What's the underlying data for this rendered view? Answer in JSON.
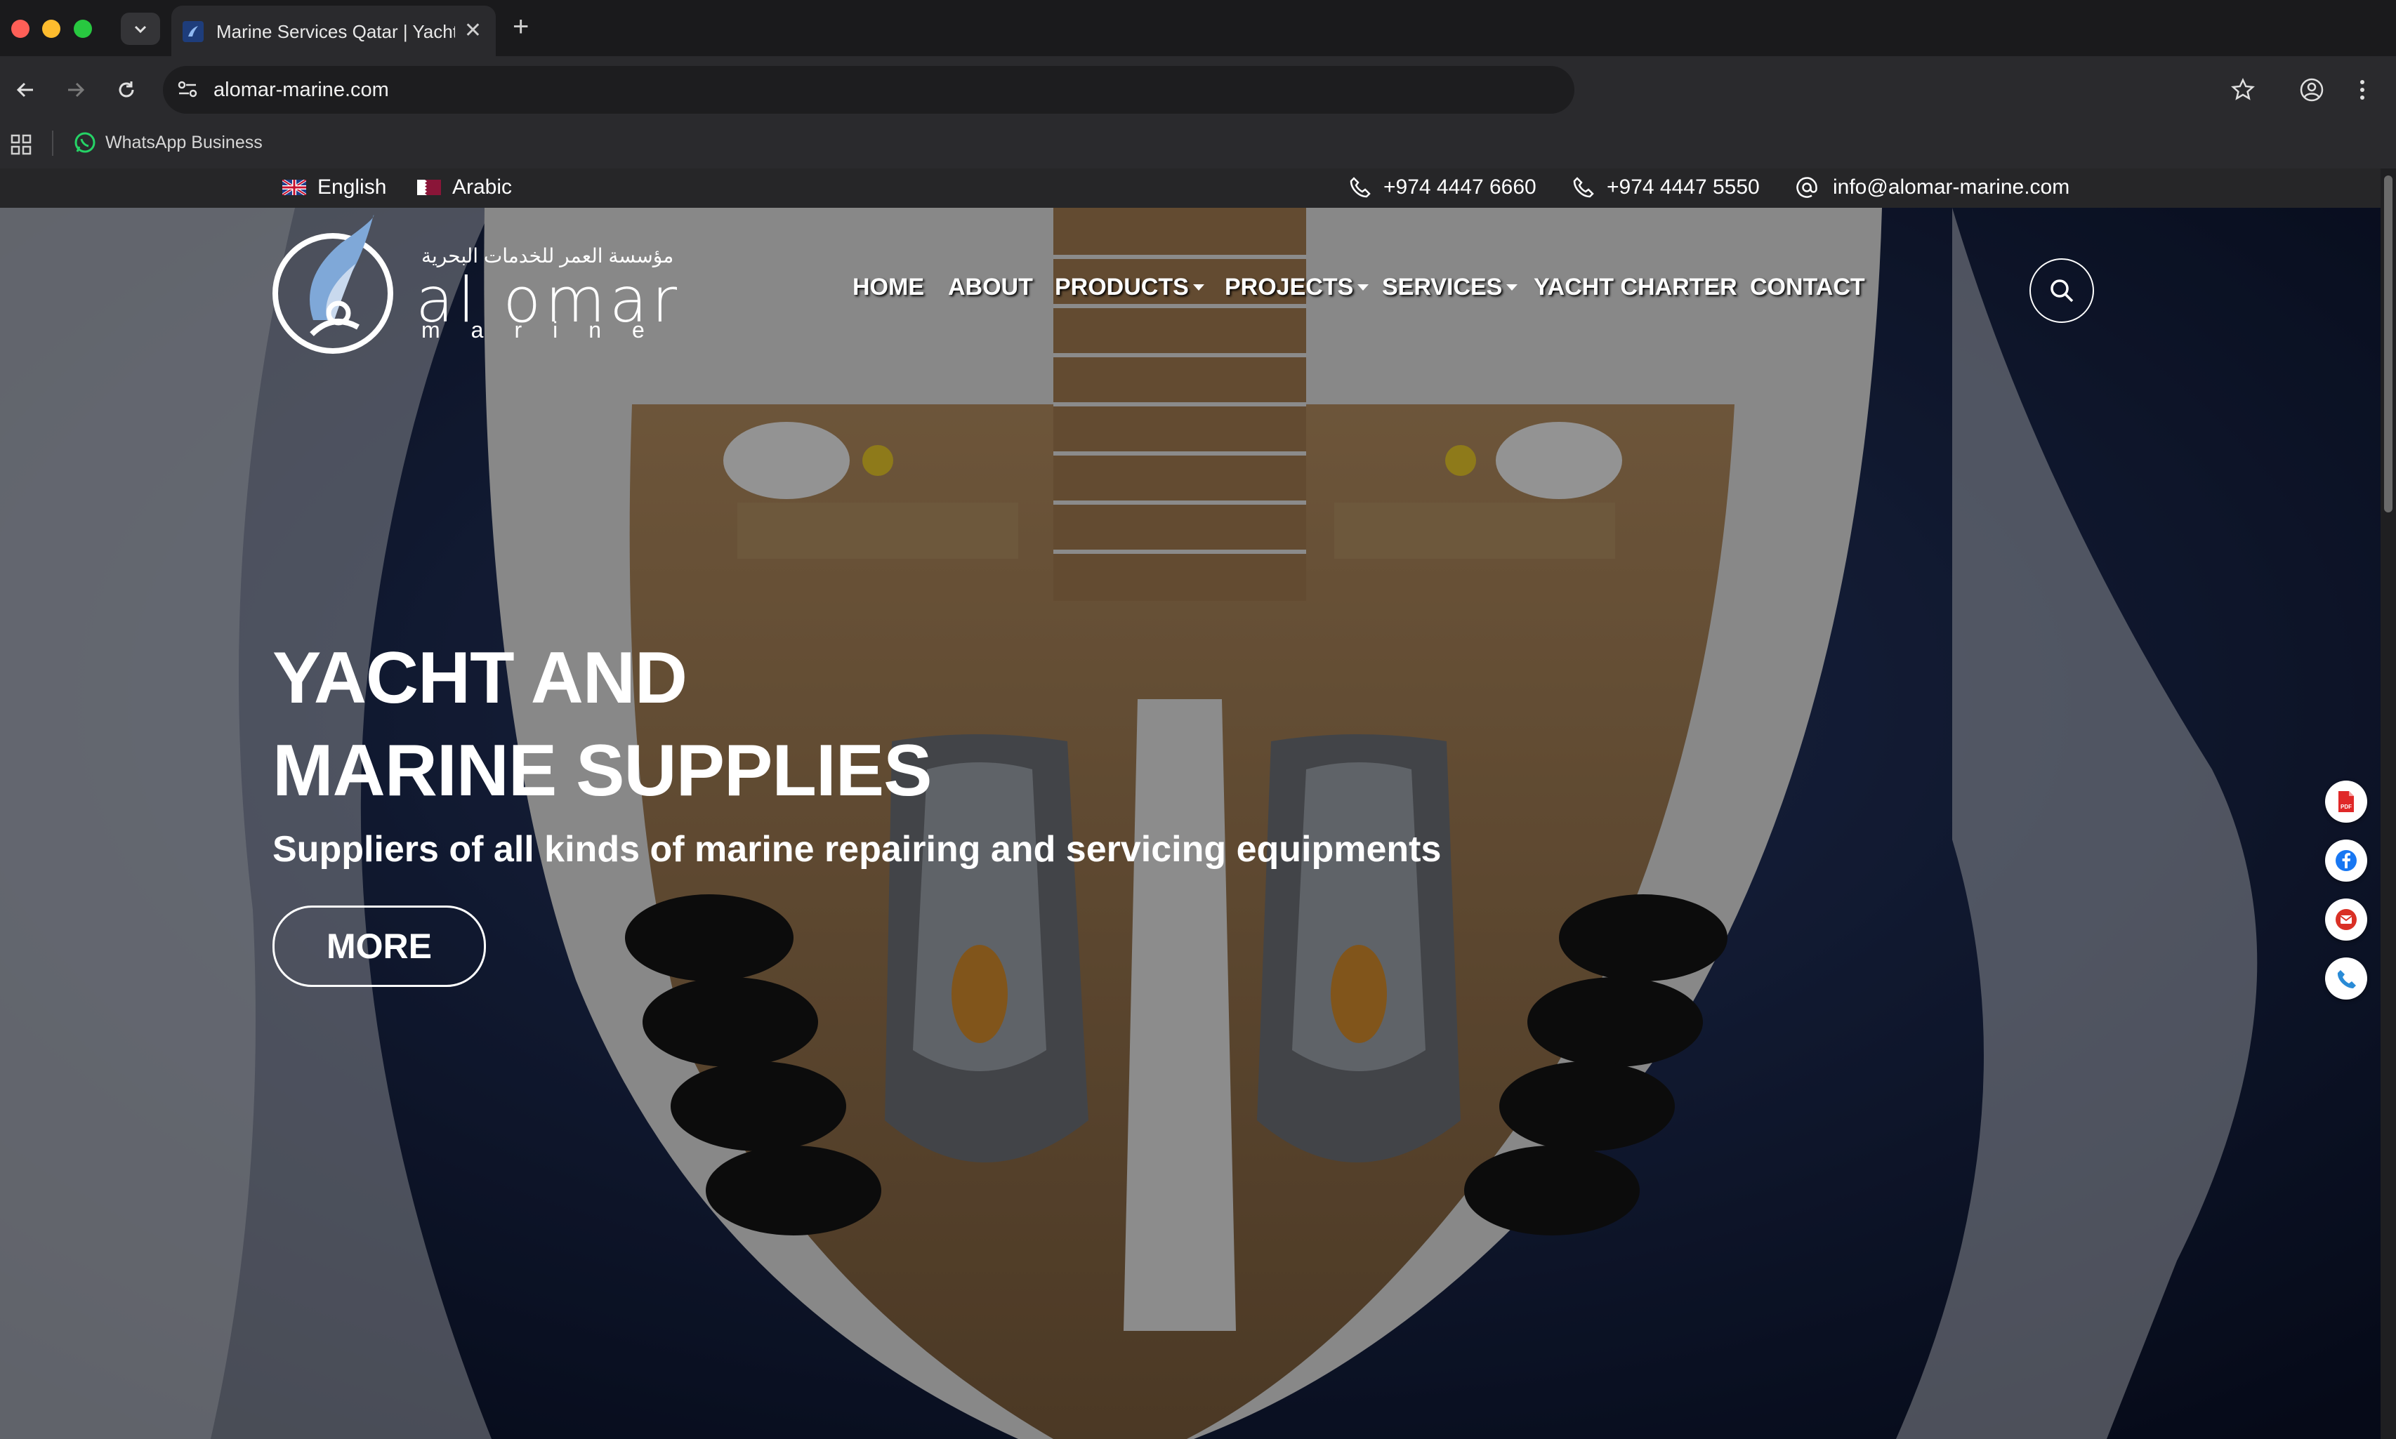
{
  "browser": {
    "tab_title": "Marine Services Qatar | Yacht",
    "url": "alomar-marine.com",
    "bookmark": "WhatsApp Business"
  },
  "topbar": {
    "languages": [
      {
        "label": "English",
        "flag": "uk-flag-icon"
      },
      {
        "label": "Arabic",
        "flag": "qatar-flag-icon"
      }
    ],
    "phone1": "+974 4447 6660",
    "phone2": "+974 4447 5550",
    "email": "info@alomar-marine.com"
  },
  "logo": {
    "arabic": "مؤسسة العمر للخدمات البحرية",
    "word": "al omar",
    "sub": "marine"
  },
  "nav": {
    "home": "HOME",
    "about": "ABOUT",
    "products": "PRODUCTS",
    "projects": "PROJECTS",
    "services": "SERVICES",
    "yacht_charter": "YACHT CHARTER",
    "contact": "CONTACT"
  },
  "hero": {
    "title_line1": "YACHT AND",
    "title_line2": "MARINE SUPPLIES",
    "subtitle": "Suppliers of all kinds of marine repairing and servicing equipments",
    "button": "MORE"
  },
  "colors": {
    "pdf": "#e02828",
    "facebook": "#1877f2",
    "mail": "#d93025",
    "phone": "#2a8bd6"
  }
}
